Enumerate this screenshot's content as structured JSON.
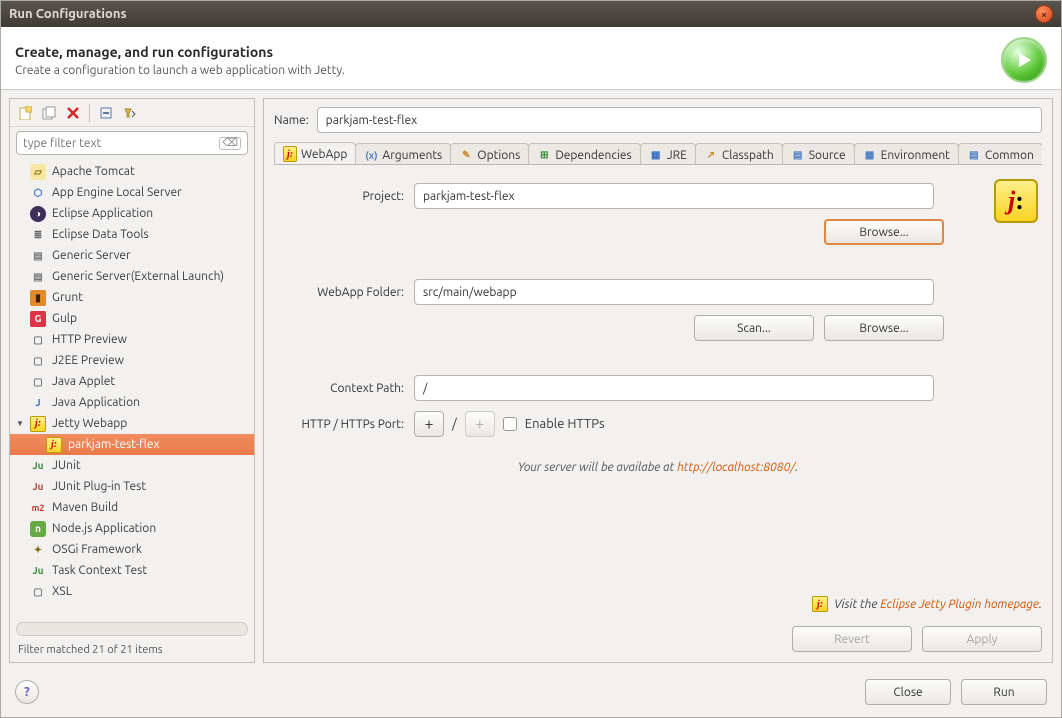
{
  "window": {
    "title": "Run Configurations"
  },
  "header": {
    "title": "Create, manage, and run configurations",
    "subtitle": "Create a configuration to launch a web application with Jetty."
  },
  "filter": {
    "placeholder": "type filter text"
  },
  "tree": {
    "items": [
      {
        "label": "Apache Tomcat",
        "icon": "tomcat"
      },
      {
        "label": "App Engine Local Server",
        "icon": "appengine"
      },
      {
        "label": "Eclipse Application",
        "icon": "eclipse"
      },
      {
        "label": "Eclipse Data Tools",
        "icon": "db"
      },
      {
        "label": "Generic Server",
        "icon": "server"
      },
      {
        "label": "Generic Server(External Launch)",
        "icon": "server"
      },
      {
        "label": "Grunt",
        "icon": "grunt"
      },
      {
        "label": "Gulp",
        "icon": "gulp"
      },
      {
        "label": "HTTP Preview",
        "icon": "http"
      },
      {
        "label": "J2EE Preview",
        "icon": "j2ee"
      },
      {
        "label": "Java Applet",
        "icon": "applet"
      },
      {
        "label": "Java Application",
        "icon": "java"
      },
      {
        "label": "Jetty Webapp",
        "icon": "jetty",
        "expanded": true,
        "children": [
          {
            "label": "parkjam-test-flex",
            "icon": "jetty",
            "selected": true
          }
        ]
      },
      {
        "label": "JUnit",
        "icon": "junit"
      },
      {
        "label": "JUnit Plug-in Test",
        "icon": "junitplug"
      },
      {
        "label": "Maven Build",
        "icon": "maven"
      },
      {
        "label": "Node.js Application",
        "icon": "node"
      },
      {
        "label": "OSGi Framework",
        "icon": "osgi"
      },
      {
        "label": "Task Context Test",
        "icon": "task"
      },
      {
        "label": "XSL",
        "icon": "xsl"
      }
    ]
  },
  "filterStatus": "Filter matched 21 of 21 items",
  "name": {
    "label": "Name:",
    "value": "parkjam-test-flex"
  },
  "tabs": [
    {
      "id": "webapp",
      "label": "WebApp",
      "active": true
    },
    {
      "id": "arguments",
      "label": "Arguments"
    },
    {
      "id": "options",
      "label": "Options"
    },
    {
      "id": "dependencies",
      "label": "Dependencies"
    },
    {
      "id": "jre",
      "label": "JRE"
    },
    {
      "id": "classpath",
      "label": "Classpath"
    },
    {
      "id": "source",
      "label": "Source"
    },
    {
      "id": "environment",
      "label": "Environment"
    },
    {
      "id": "common",
      "label": "Common"
    }
  ],
  "form": {
    "projectLabel": "Project:",
    "projectValue": "parkjam-test-flex",
    "browse": "Browse...",
    "webappFolderLabel": "WebApp Folder:",
    "webappFolderValue": "src/main/webapp",
    "scan": "Scan...",
    "contextLabel": "Context Path:",
    "contextValue": "/",
    "portLabel": "HTTP / HTTPs Port:",
    "portSep": "/",
    "enableHttps": "Enable HTTPs",
    "serverInfoPrefix": "Your server will be availabe at ",
    "serverUrl": "http://localhost:8080/",
    "serverInfoSuffix": ".",
    "homepagePrefix": "Visit the ",
    "homepageLink": "Eclipse Jetty Plugin homepage",
    "homepageSuffix": "."
  },
  "buttons": {
    "revert": "Revert",
    "apply": "Apply",
    "close": "Close",
    "run": "Run"
  }
}
